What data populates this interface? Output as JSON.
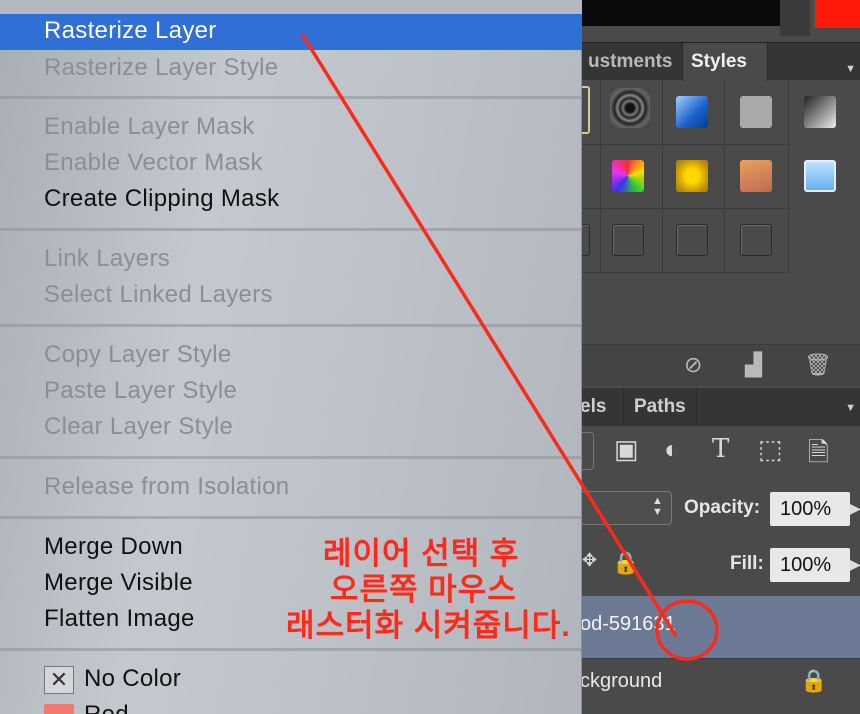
{
  "photoshop": {
    "tabs_top": [
      "ustments",
      "Styles"
    ],
    "tabs_layers": [
      "els",
      "Paths"
    ],
    "opacity_label": "Opacity:",
    "opacity_value": "100%",
    "fill_label": "Fill:",
    "fill_value": "100%",
    "selected_layer_name": "od-591631",
    "background_layer_name": "ckground",
    "colors": {
      "foreground_color": "#ff1a0a",
      "selected_layer_bg": "#6b7995"
    }
  },
  "context_menu": {
    "highlighted_item": "Rasterize Layer",
    "groups": [
      [
        {
          "label": "Rasterize Layer Style",
          "enabled": false
        }
      ],
      [
        {
          "label": "Enable Layer Mask",
          "enabled": false
        },
        {
          "label": "Enable Vector Mask",
          "enabled": false
        },
        {
          "label": "Create Clipping Mask",
          "enabled": true
        }
      ],
      [
        {
          "label": "Link Layers",
          "enabled": false
        },
        {
          "label": "Select Linked Layers",
          "enabled": false
        }
      ],
      [
        {
          "label": "Copy Layer Style",
          "enabled": false
        },
        {
          "label": "Paste Layer Style",
          "enabled": false
        },
        {
          "label": "Clear Layer Style",
          "enabled": false
        }
      ],
      [
        {
          "label": "Release from Isolation",
          "enabled": false
        }
      ],
      [
        {
          "label": "Merge Down",
          "enabled": true
        },
        {
          "label": "Merge Visible",
          "enabled": true
        },
        {
          "label": "Flatten Image",
          "enabled": true
        }
      ]
    ],
    "color_items": [
      {
        "label": "No Color",
        "icon": "x-box-icon"
      },
      {
        "label": "Red",
        "swatch": "#f07a6e"
      }
    ],
    "highlight_color": "#2f6fd6"
  },
  "annotation": {
    "lines": [
      "레이어 선택 후",
      "오른쪽 마우스",
      "래스터화 시켜줍니다."
    ],
    "color": "#ff2a1a"
  }
}
